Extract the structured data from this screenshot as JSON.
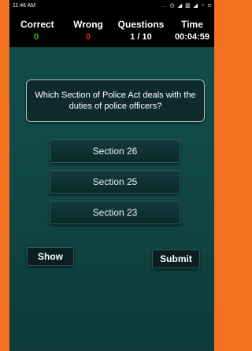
{
  "status": {
    "time": "11:46 AM",
    "icons_text": "... ◷ ◢ ▥ ◢ ◔ ⊂"
  },
  "stats": {
    "correct_label": "Correct",
    "correct_value": "0",
    "wrong_label": "Wrong",
    "wrong_value": "0",
    "questions_label": "Questions",
    "questions_value": "1 / 10",
    "time_label": "Time",
    "time_value": "00:04:59"
  },
  "question": "Which Section of Police Act deals with the duties of police officers?",
  "options": [
    "Section 26",
    "Section 25",
    "Section 23"
  ],
  "buttons": {
    "show": "Show",
    "submit": "Submit"
  },
  "colors": {
    "accent_orange": "#f37021",
    "correct": "#19c619",
    "wrong": "#e81a1a",
    "background": "#114a48"
  }
}
